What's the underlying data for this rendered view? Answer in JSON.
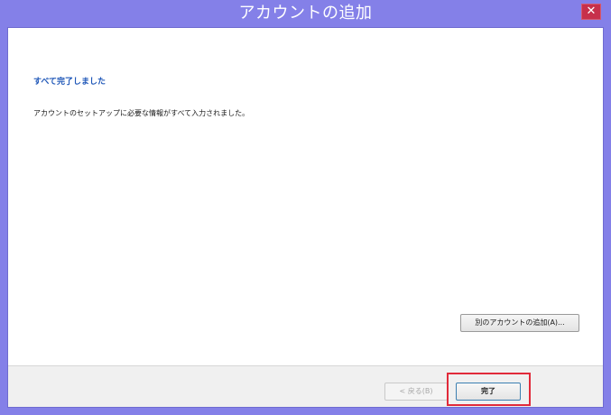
{
  "window": {
    "title": "アカウントの追加",
    "close_icon": "close-icon",
    "close_glyph": "✕"
  },
  "content": {
    "heading": "すべて完了しました",
    "message": "アカウントのセットアップに必要な情報がすべて入力されました。"
  },
  "buttons": {
    "add_another_account": "別のアカウントの追加(A)...",
    "back": "< 戻る(B)",
    "finish": "完了"
  },
  "colors": {
    "frame": "#8480e8",
    "heading": "#1f57b8",
    "close_button": "#c7304b",
    "highlight": "#e12a3a"
  }
}
